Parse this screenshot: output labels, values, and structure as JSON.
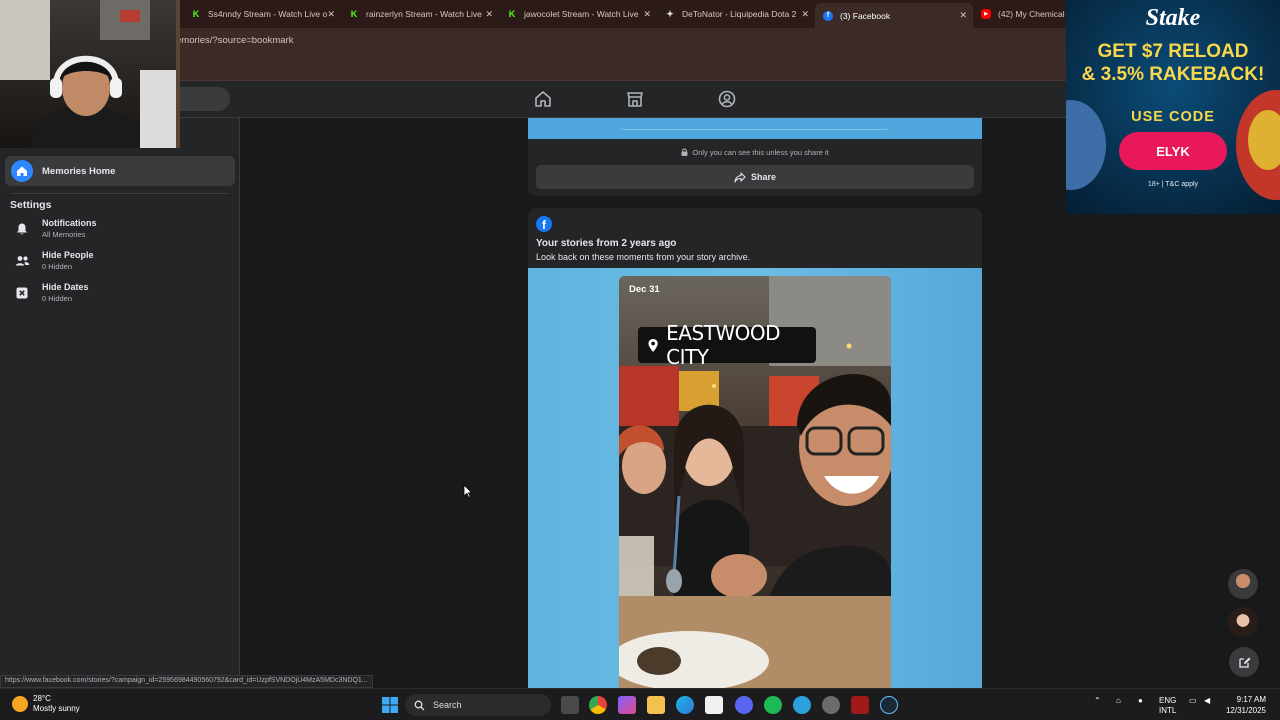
{
  "browser": {
    "tabs": [
      {
        "title": "Ss4nndy Stream - Watch Live o",
        "favicon": "kick-icon"
      },
      {
        "title": "rainzerlyn Stream - Watch Live",
        "favicon": "kick-icon"
      },
      {
        "title": "jawocolet Stream - Watch Live",
        "favicon": "kick-icon"
      },
      {
        "title": "DeToNator - Liquipedia Dota 2",
        "favicon": "liquipedia-icon"
      },
      {
        "title": "(3) Facebook",
        "favicon": "facebook-icon"
      },
      {
        "title": "(42) My Chemical R",
        "favicon": "youtube-icon"
      }
    ],
    "url_fragment": "emories/?source=bookmark",
    "status_url": "https://www.facebook.com/stories/?campaign_id=25956984490560792&card_id=UzpfSVNDOjU4MzA5MDc3NDQ1..."
  },
  "sidebar": {
    "memories_home": "Memories Home",
    "settings_heading": "Settings",
    "items": [
      {
        "title": "Notifications",
        "subtitle": "All Memories",
        "icon": "bell-icon"
      },
      {
        "title": "Hide People",
        "subtitle": "0 Hidden",
        "icon": "people-icon"
      },
      {
        "title": "Hide Dates",
        "subtitle": "0 Hidden",
        "icon": "calendar-x-icon"
      }
    ]
  },
  "feed": {
    "privacy_note": "Only you can see this unless you share it",
    "share_label": "Share",
    "story": {
      "title": "Your stories from 2 years ago",
      "subtitle": "Look back on these moments from your story archive.",
      "date": "Dec 31",
      "location": "EASTWOOD CITY"
    }
  },
  "ad": {
    "brand": "Stake",
    "headline_1": "GET $7 RELOAD",
    "headline_2": "& 3.5% RAKEBACK!",
    "use_code": "USE CODE",
    "code": "ELYK",
    "fine_print": "18+ | T&C apply"
  },
  "taskbar": {
    "temperature": "28°C",
    "weather": "Mostly sunny",
    "search_label": "Search",
    "lang_1": "ENG",
    "lang_2": "INTL",
    "time": "9:17 AM",
    "date": "12/31/2025"
  },
  "colors": {
    "fb_blue": "#1877f2",
    "story_bg": "#5fb4de",
    "stake_pink": "#e8185a",
    "stake_yellow": "#f8d74b"
  }
}
